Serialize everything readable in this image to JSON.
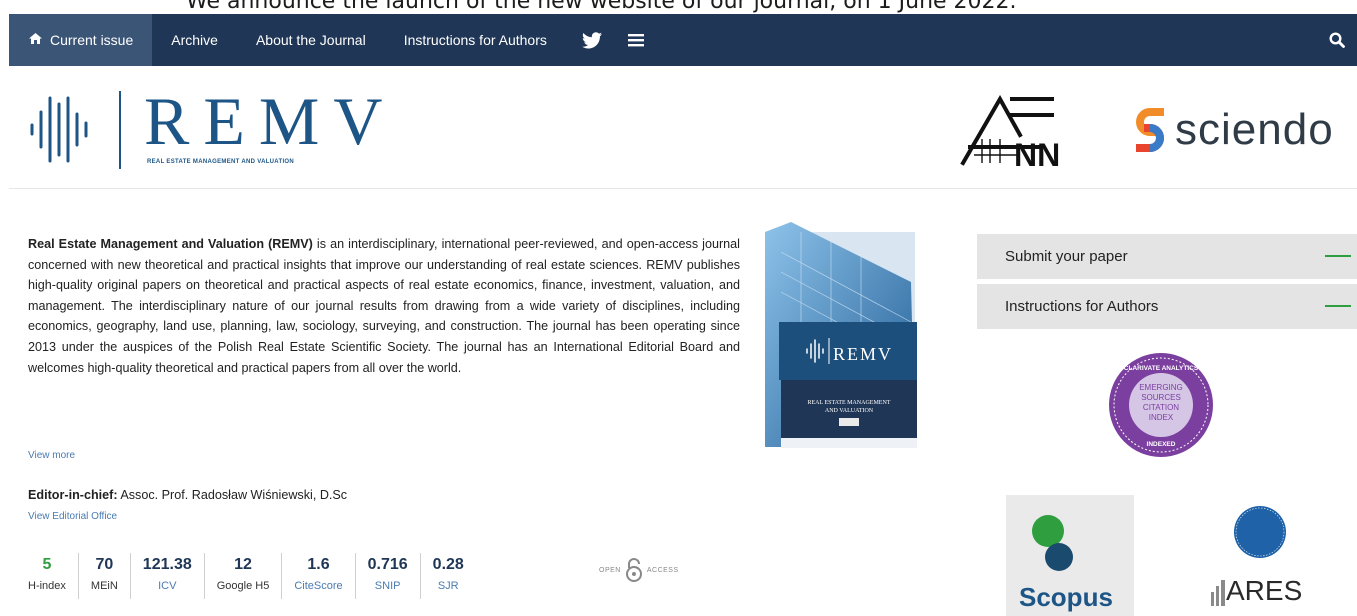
{
  "announcement": "We announce the launch of the new website of our journal, on 1 June 2022.",
  "nav": {
    "items": [
      {
        "label": "Current issue",
        "active": true,
        "icon": "home-icon"
      },
      {
        "label": "Archive"
      },
      {
        "label": "About the Journal"
      },
      {
        "label": "Instructions for Authors"
      }
    ],
    "icons": [
      "twitter-icon",
      "menu-icon",
      "search-icon"
    ]
  },
  "logo": {
    "title": "REMV",
    "subtitle": "REAL ESTATE MANAGEMENT AND VALUATION"
  },
  "partners": {
    "sciendo": "sciendo",
    "ac_logo_letters": "NN"
  },
  "description": {
    "journal_name": "Real Estate Management and Valuation (REMV)",
    "text": " is an interdisciplinary, international peer-reviewed, and open-access journal concerned with new theoretical and practical insights that improve our understanding of real estate sciences. REMV publishes high-quality original papers on theoretical and practical aspects of real estate economics, finance, investment, valuation, and management. The interdisciplinary nature of our journal results from drawing from a wide variety of disciplines, including economics, geography, land use, planning, law, sociology, surveying, and construction. The journal has been operating since 2013 under the auspices of the Polish Real Estate Scientific Society. The journal has an International Editorial Board and welcomes high-quality theoretical and practical papers from all over the world.",
    "view_more": "View more"
  },
  "editor": {
    "label": "Editor-in-chief:",
    "name": "Assoc. Prof. Radosław Wiśniewski, D.Sc",
    "view_office": "View Editorial Office"
  },
  "metrics": [
    {
      "value": "5",
      "label": "H-index",
      "link": false
    },
    {
      "value": "70",
      "label": "MEiN",
      "link": false
    },
    {
      "value": "121.38",
      "label": "ICV",
      "link": true
    },
    {
      "value": "12",
      "label": "Google H5",
      "link": false
    },
    {
      "value": "1.6",
      "label": "CiteScore",
      "link": true
    },
    {
      "value": "0.716",
      "label": "SNIP",
      "link": true
    },
    {
      "value": "0.28",
      "label": "SJR",
      "link": true
    }
  ],
  "open_access": {
    "left": "OPEN",
    "right": "ACCESS"
  },
  "cover": {
    "title": "REMV",
    "line1": "REAL ESTATE MANAGEMENT",
    "line2": "AND VALUATION"
  },
  "sidebar": {
    "submit": "Submit your paper",
    "instructions": "Instructions for Authors"
  },
  "esci": {
    "top": "CLARIVATE ANALYTICS",
    "l1": "EMERGING",
    "l2": "SOURCES",
    "l3": "CITATION",
    "l4": "INDEX",
    "bottom": "INDEXED"
  },
  "scopus": "Scopus",
  "ares": "ARES",
  "colors": {
    "nav_bg": "#1f3656",
    "nav_active": "#3b5577",
    "brand_blue": "#1d5686",
    "accent_green": "#2e9e3e",
    "esci_purple": "#7b3fa0"
  }
}
